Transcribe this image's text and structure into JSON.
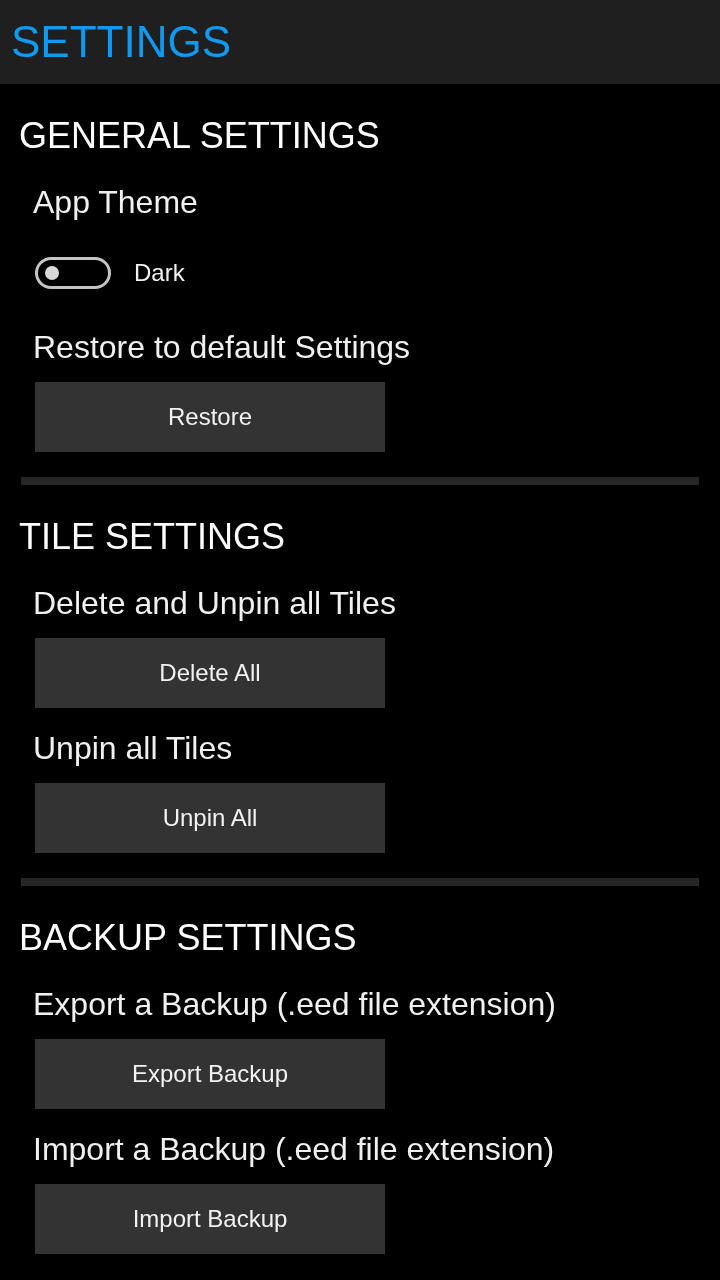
{
  "header": {
    "title": "SETTINGS"
  },
  "sections": [
    {
      "heading": "GENERAL SETTINGS",
      "items": [
        {
          "kind": "label",
          "text": "App Theme"
        },
        {
          "kind": "toggle",
          "label": "Dark",
          "on": false
        },
        {
          "kind": "label",
          "text": "Restore to default Settings"
        },
        {
          "kind": "button",
          "label": "Restore"
        }
      ]
    },
    {
      "heading": "TILE SETTINGS",
      "items": [
        {
          "kind": "label",
          "text": "Delete and Unpin all Tiles"
        },
        {
          "kind": "button",
          "label": "Delete All"
        },
        {
          "kind": "label",
          "text": "Unpin all Tiles"
        },
        {
          "kind": "button",
          "label": "Unpin All"
        }
      ]
    },
    {
      "heading": "BACKUP SETTINGS",
      "items": [
        {
          "kind": "label",
          "text": "Export a Backup (.eed file extension)"
        },
        {
          "kind": "button",
          "label": "Export Backup"
        },
        {
          "kind": "label",
          "text": "Import a Backup (.eed file extension)"
        },
        {
          "kind": "button",
          "label": "Import Backup"
        }
      ]
    }
  ]
}
